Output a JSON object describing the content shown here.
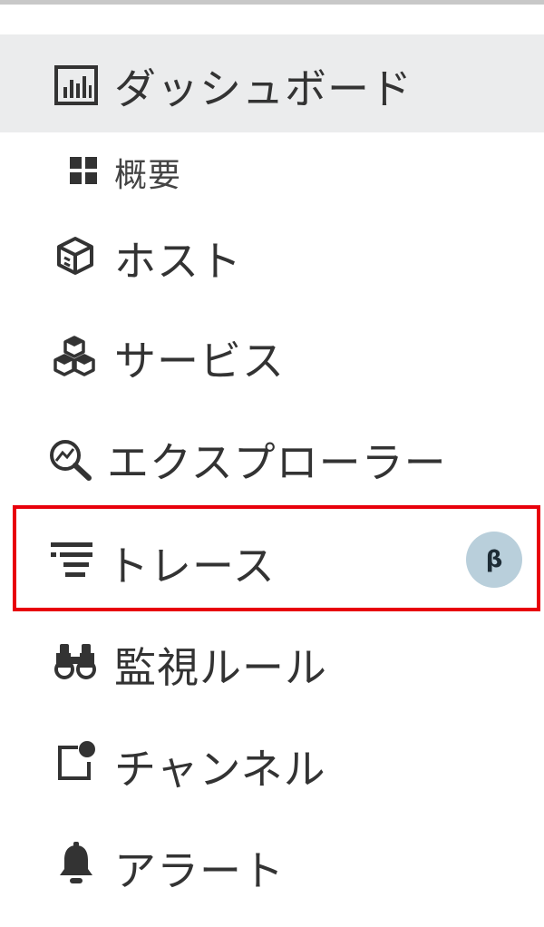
{
  "menu": {
    "dashboard": {
      "label": "ダッシュボード",
      "icon": "dashboard-chart-icon"
    },
    "overview": {
      "label": "概要",
      "icon": "grid-icon"
    },
    "hosts": {
      "label": "ホスト",
      "icon": "cube-icon"
    },
    "services": {
      "label": "サービス",
      "icon": "cubes-icon"
    },
    "explorer": {
      "label": "エクスプローラー",
      "icon": "magnifier-icon"
    },
    "traces": {
      "label": "トレース",
      "icon": "filter-lines-icon",
      "badge": "β"
    },
    "monitor_rules": {
      "label": "監視ルール",
      "icon": "binoculars-icon"
    },
    "channels": {
      "label": "チャンネル",
      "icon": "channel-notification-icon"
    },
    "alerts": {
      "label": "アラート",
      "icon": "bell-icon"
    }
  },
  "colors": {
    "active_background": "#ebeced",
    "highlight_border": "#e8000b",
    "beta_badge_bg": "#b9cfdb",
    "text": "#333333"
  }
}
